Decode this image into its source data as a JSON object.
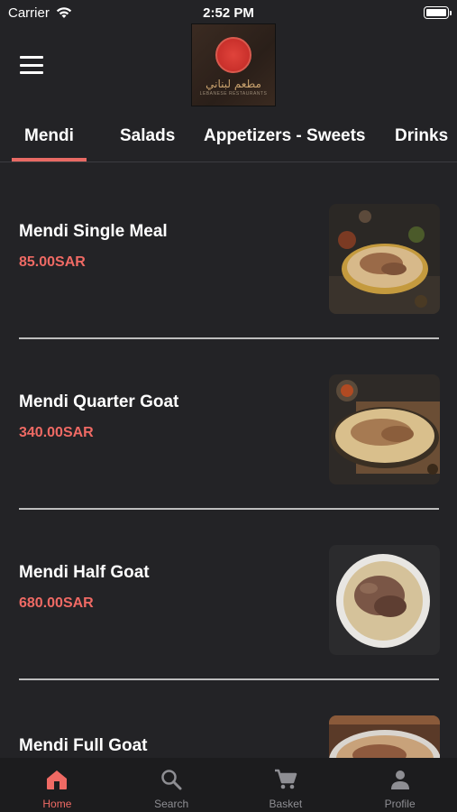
{
  "status_bar": {
    "carrier": "Carrier",
    "time": "2:52 PM"
  },
  "header": {
    "logo_arabic": "مطعم لبناني",
    "logo_subtitle": "LEBANESE RESTAURANTS"
  },
  "tabs": [
    {
      "label": "Mendi",
      "active": true
    },
    {
      "label": "Salads",
      "active": false
    },
    {
      "label": "Appetizers - Sweets",
      "active": false
    },
    {
      "label": "Drinks",
      "active": false
    }
  ],
  "items": [
    {
      "name": "Mendi Single Meal",
      "price": "85.00SAR"
    },
    {
      "name": "Mendi Quarter Goat",
      "price": "340.00SAR"
    },
    {
      "name": "Mendi Half Goat",
      "price": "680.00SAR"
    },
    {
      "name": "Mendi Full Goat",
      "price": ""
    }
  ],
  "tabbar": [
    {
      "label": "Home",
      "icon": "home-icon",
      "active": true
    },
    {
      "label": "Search",
      "icon": "search-icon",
      "active": false
    },
    {
      "label": "Basket",
      "icon": "cart-icon",
      "active": false
    },
    {
      "label": "Profile",
      "icon": "profile-icon",
      "active": false
    }
  ],
  "colors": {
    "background": "#232326",
    "accent": "#ef6a64",
    "tabbar_background": "#1c1c1e",
    "inactive": "#8e8e93"
  }
}
